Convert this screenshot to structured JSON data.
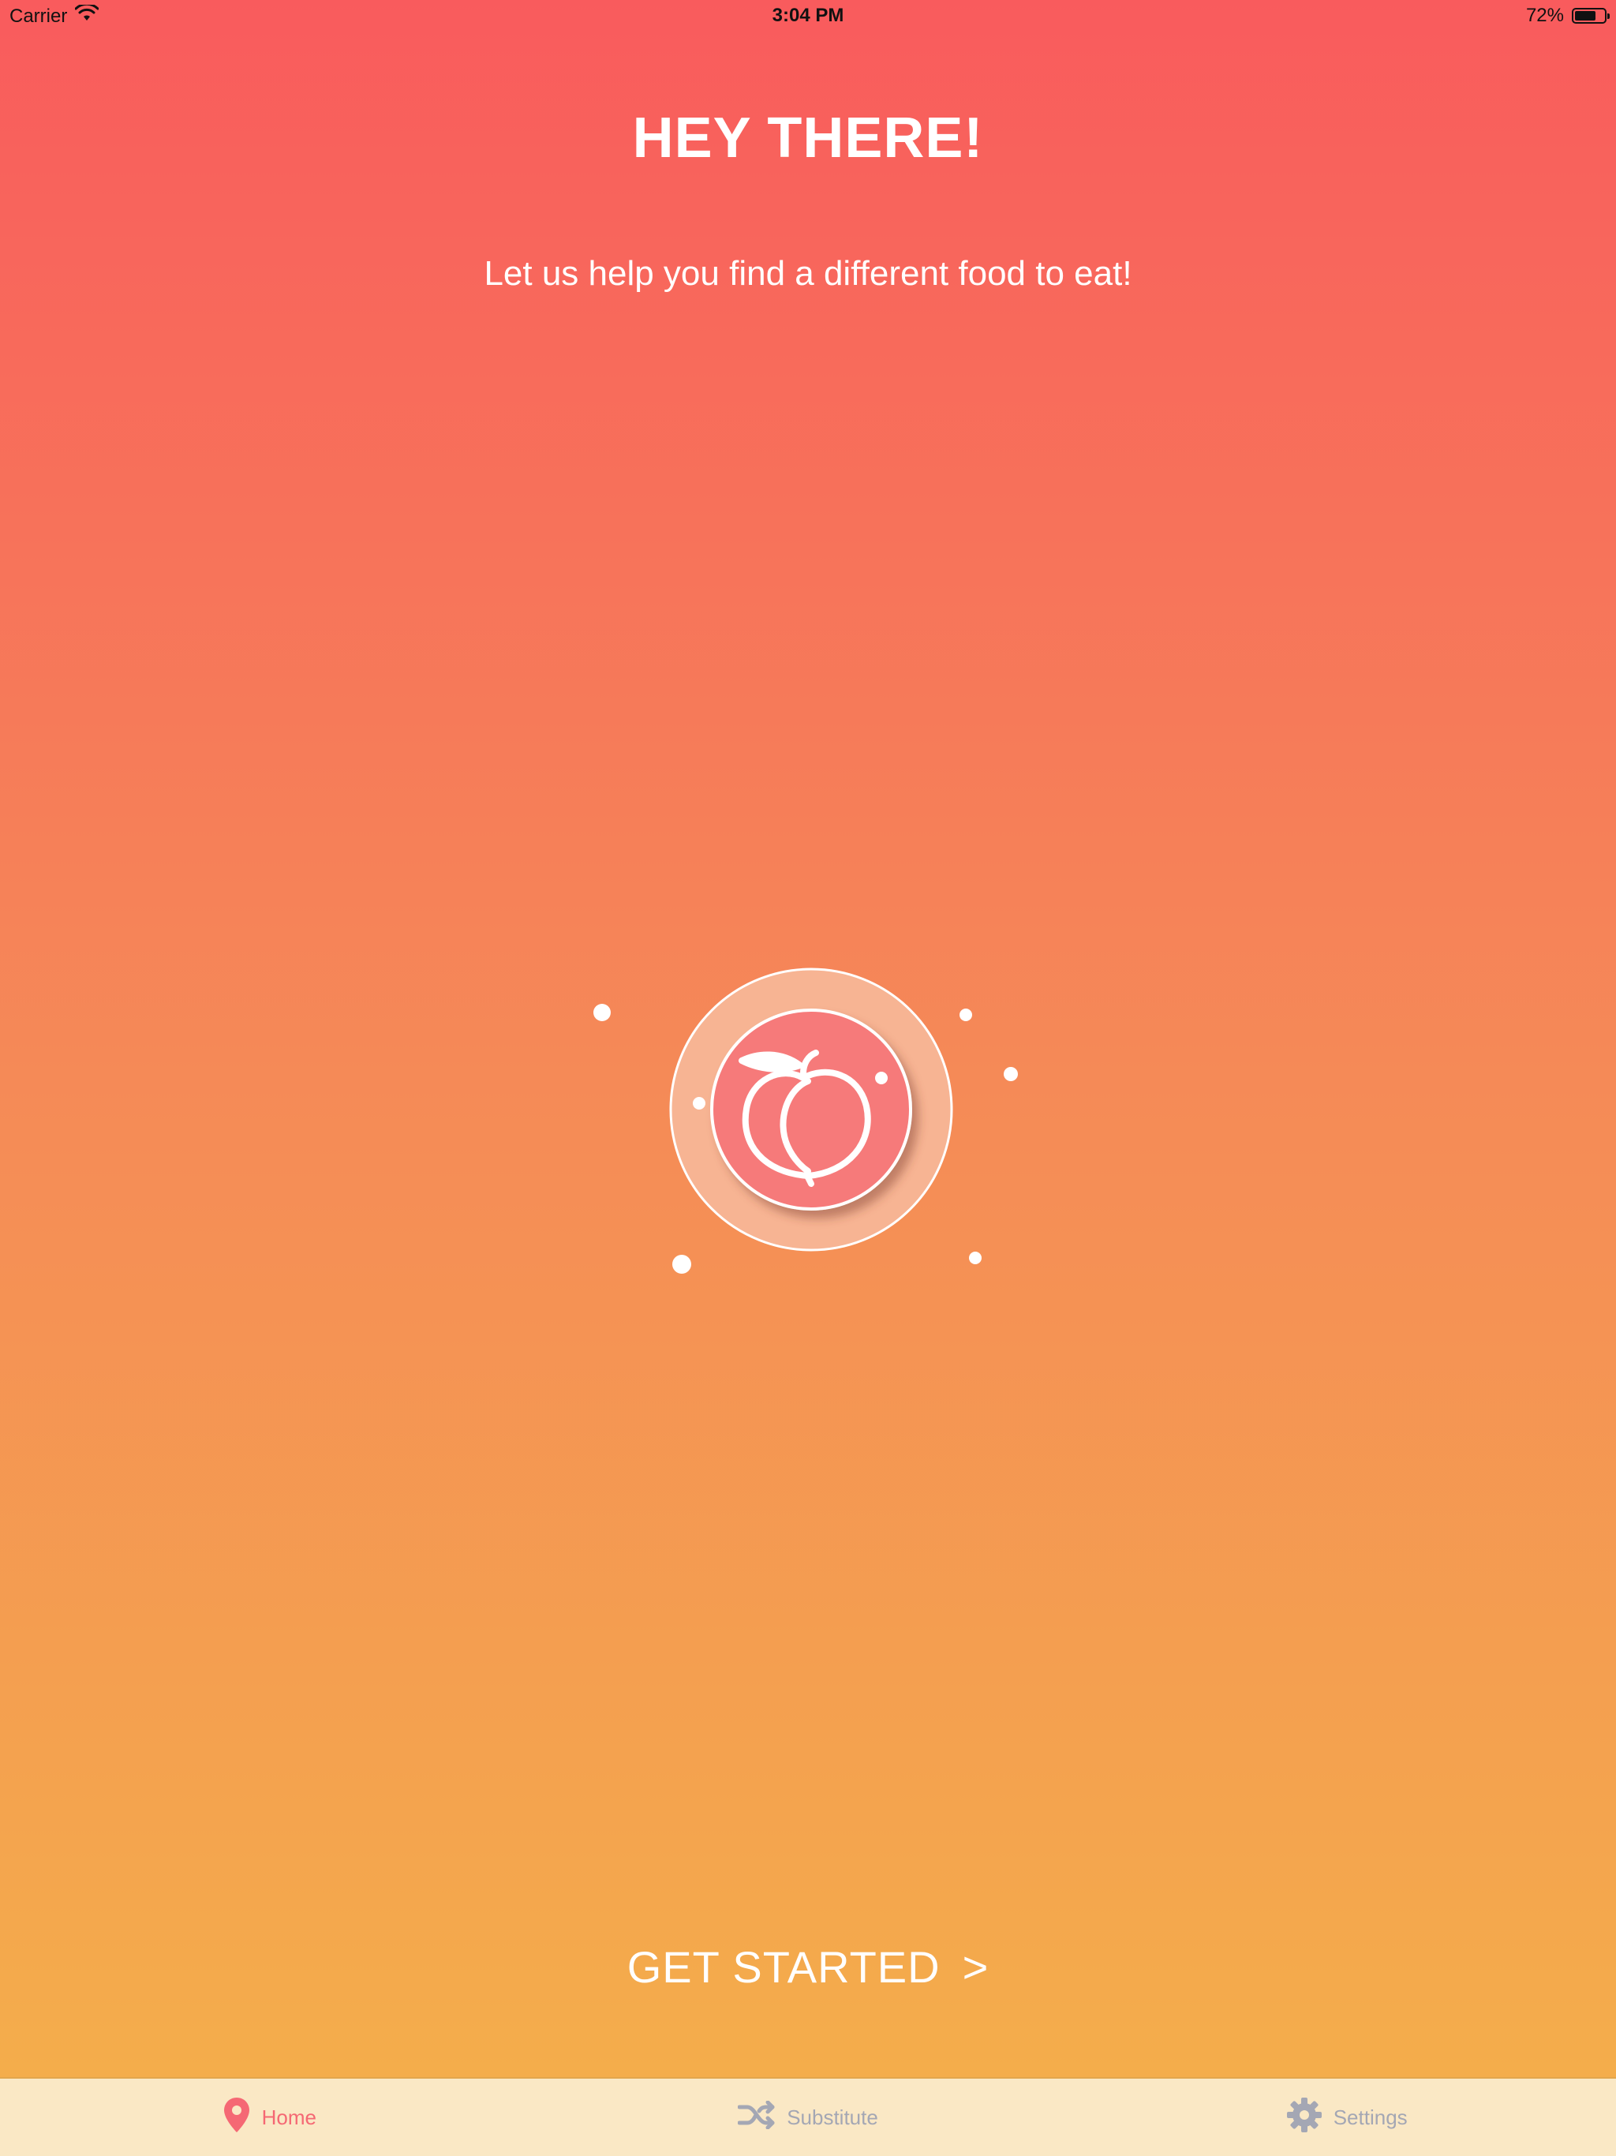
{
  "status_bar": {
    "carrier": "Carrier",
    "time": "3:04 PM",
    "battery": "72%",
    "battery_level": 0.72
  },
  "header": {
    "title": "HEY THERE!",
    "subtitle": "Let us help you find a different food to eat!"
  },
  "logo": {
    "icon": "peach-icon"
  },
  "cta": {
    "label": "GET STARTED",
    "arrow": ">"
  },
  "tabs": [
    {
      "label": "Home",
      "icon": "map-pin-icon",
      "active": true
    },
    {
      "label": "Substitute",
      "icon": "shuffle-icon",
      "active": false
    },
    {
      "label": "Settings",
      "icon": "gear-icon",
      "active": false
    }
  ],
  "colors": {
    "gradient_top": "#f95b5d",
    "gradient_bottom": "#f4b04a",
    "accent": "#f56874",
    "tab_inactive": "#a4a7b4",
    "tab_bar_bg": "#fae8c5"
  }
}
